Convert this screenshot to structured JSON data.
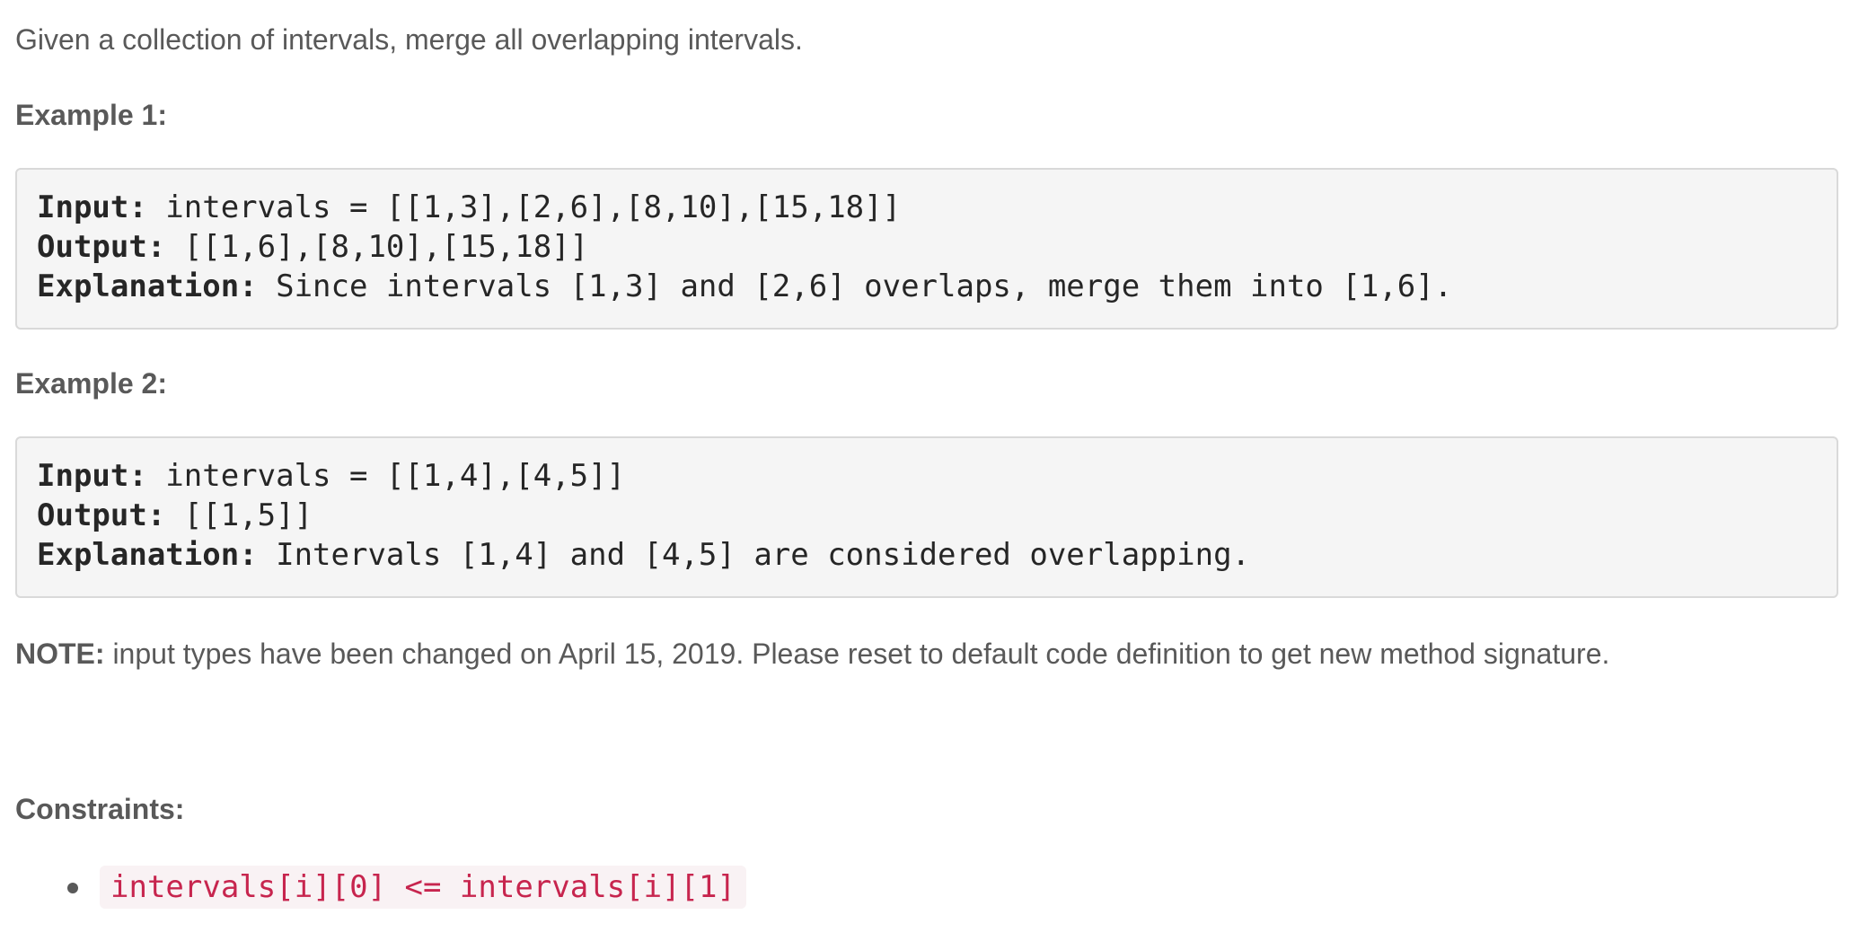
{
  "intro": "Given a collection of intervals, merge all overlapping intervals.",
  "examples": [
    {
      "title": "Example 1:",
      "input_label": "Input:",
      "input_value": " intervals = [[1,3],[2,6],[8,10],[15,18]]",
      "output_label": "Output:",
      "output_value": " [[1,6],[8,10],[15,18]]",
      "explanation_label": "Explanation:",
      "explanation_value": " Since intervals [1,3] and [2,6] overlaps, merge them into [1,6]."
    },
    {
      "title": "Example 2:",
      "input_label": "Input:",
      "input_value": " intervals = [[1,4],[4,5]]",
      "output_label": "Output:",
      "output_value": " [[1,5]]",
      "explanation_label": "Explanation:",
      "explanation_value": " Intervals [1,4] and [4,5] are considered overlapping."
    }
  ],
  "note": {
    "label": "NOTE:",
    "text": " input types have been changed on April 15, 2019. Please reset to default code definition to get new method signature."
  },
  "constraints": {
    "title": "Constraints:",
    "items": [
      "intervals[i][0] <= intervals[i][1]"
    ]
  },
  "colors": {
    "text": "#595959",
    "code_text": "#262626",
    "code_background": "#f5f5f5",
    "inline_code_text": "#c7254e",
    "inline_code_background": "#f9f2f4"
  }
}
